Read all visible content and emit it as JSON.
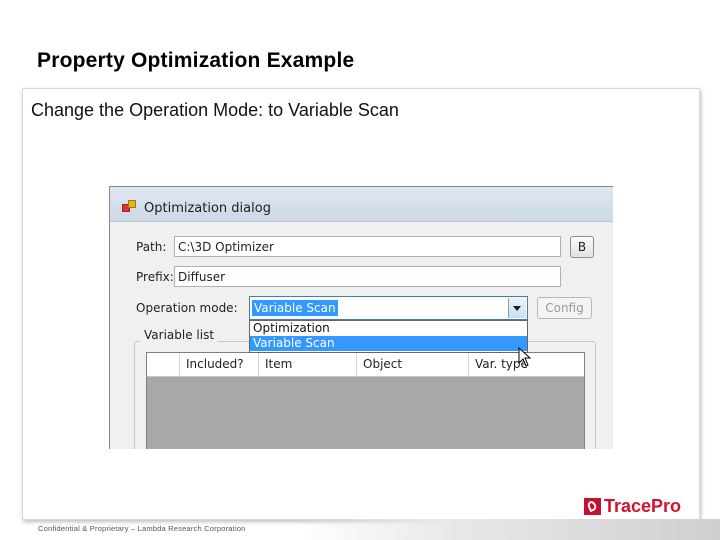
{
  "slide": {
    "title": "Property Optimization Example",
    "subtitle": "Change the Operation Mode: to Variable Scan"
  },
  "dialog": {
    "title": "Optimization dialog",
    "path_label": "Path:",
    "path_value": "C:\\3D Optimizer",
    "browse_label": "B",
    "prefix_label": "Prefix:",
    "prefix_value": "Diffuser",
    "operation_mode_label": "Operation mode:",
    "operation_mode_value": "Variable Scan",
    "config_label": "Config",
    "dropdown_options": [
      "Optimization",
      "Variable Scan"
    ],
    "variable_list_label": "Variable list",
    "columns": [
      "Included?",
      "Item",
      "Object",
      "Var. type"
    ]
  },
  "footer": {
    "confidential": "Confidential & Proprietary – Lambda Research Corporation",
    "logo_text": "TracePro"
  },
  "colors": {
    "accent": "#3399ff",
    "brand": "#d6112f"
  }
}
